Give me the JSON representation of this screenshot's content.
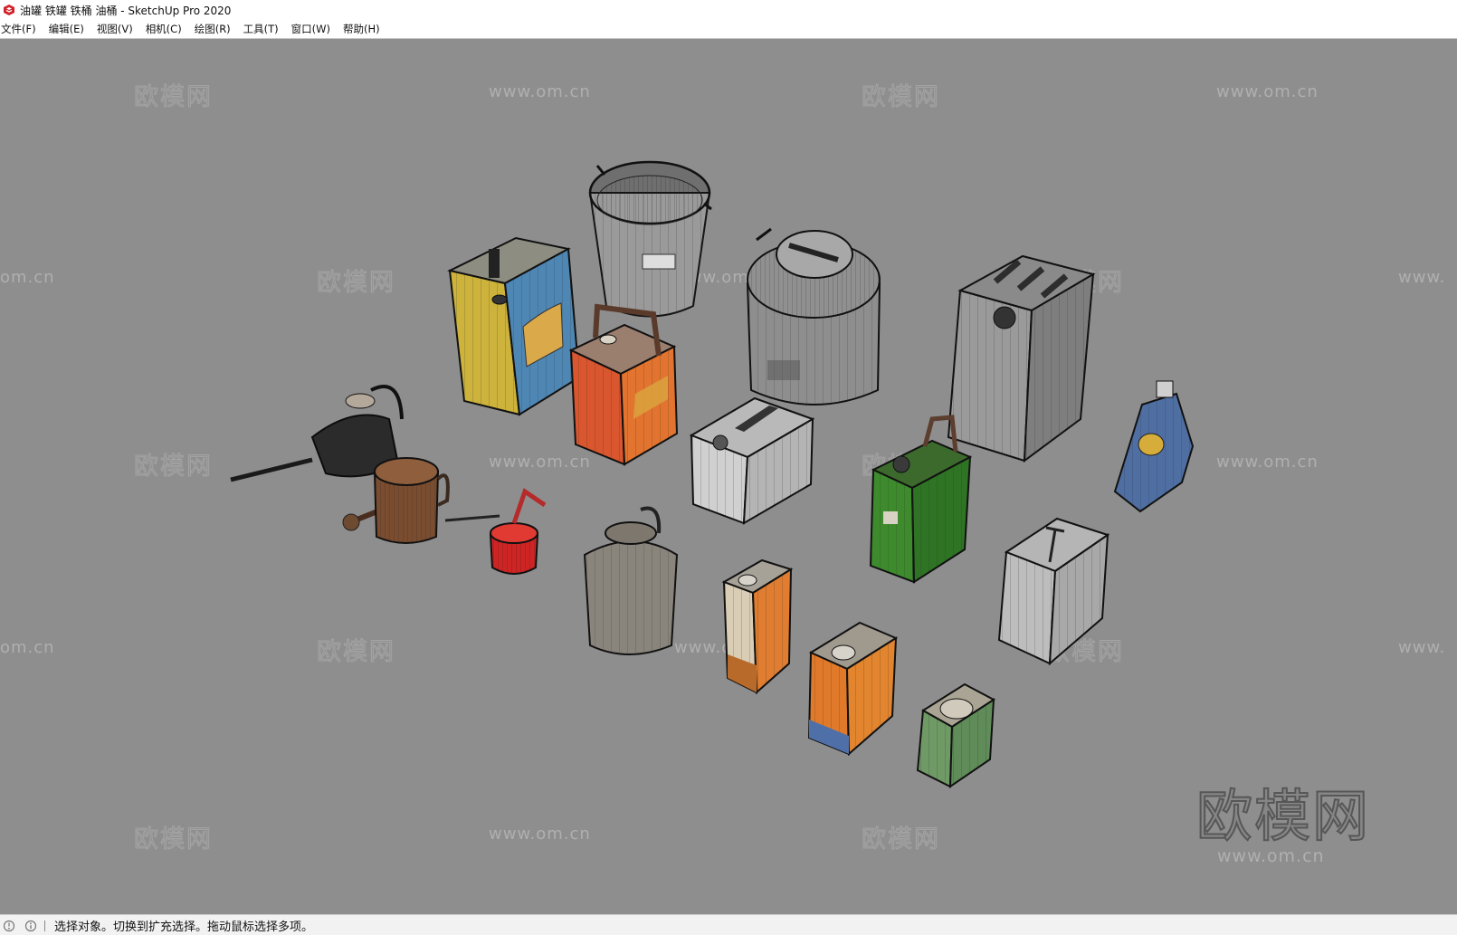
{
  "window": {
    "title": "油罐 铁罐 铁桶 油桶 - SketchUp Pro 2020",
    "icon": "sketchup-logo-icon",
    "accent_color": "#d2232a"
  },
  "menu": [
    {
      "id": "file",
      "label": "文件(F)"
    },
    {
      "id": "edit",
      "label": "编辑(E)"
    },
    {
      "id": "view",
      "label": "视图(V)"
    },
    {
      "id": "camera",
      "label": "相机(C)"
    },
    {
      "id": "draw",
      "label": "绘图(R)"
    },
    {
      "id": "tools",
      "label": "工具(T)"
    },
    {
      "id": "window",
      "label": "窗口(W)"
    },
    {
      "id": "help",
      "label": "帮助(H)"
    }
  ],
  "watermarks": {
    "brand": "欧模网",
    "url": "www.om.cn",
    "url_partial_left": "om.cn",
    "url_partial_right": "www."
  },
  "statusbar": {
    "icons": [
      "geo-location-icon",
      "info-icon"
    ],
    "message": "选择对象。切换到扩充选择。拖动鼠标选择多项。"
  }
}
